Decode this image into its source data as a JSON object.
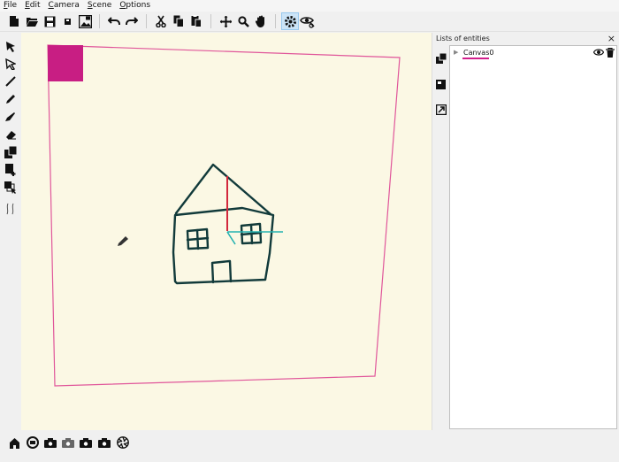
{
  "menu": {
    "file": {
      "label": "File",
      "u": "F",
      "rest": "ile"
    },
    "edit": {
      "label": "Edit",
      "u": "E",
      "rest": "dit"
    },
    "camera": {
      "label": "Camera",
      "u": "C",
      "rest": "amera"
    },
    "scene": {
      "label": "Scene",
      "u": "S",
      "rest": "cene"
    },
    "options": {
      "label": "Options",
      "u": "O",
      "rest": "ptions"
    }
  },
  "toolbar_icons": [
    "new-file-icon",
    "open-folder-icon",
    "save-icon",
    "small-save-icon",
    "export-image-icon",
    "undo-icon",
    "redo-icon",
    "cut-icon",
    "copy-icon",
    "paste-icon",
    "move-icon",
    "zoom-icon",
    "pan-hand-icon",
    "settings-active-icon",
    "view-eye-icon"
  ],
  "left_tool_icons": [
    "select-arrow-icon",
    "select-partial-icon",
    "line-tool-icon",
    "pen-tool-icon",
    "brush-tool-icon",
    "eraser-icon",
    "fill-layer-icon",
    "add-layer-icon",
    "layer-select-icon",
    "stroke-style-icon"
  ],
  "panel": {
    "title": "Lists of entities",
    "close": "×",
    "entities": [
      {
        "name": "Canvas0",
        "underline_color": "#d21f8c"
      }
    ]
  },
  "bottom_icons": [
    "home-icon",
    "camera-reset-icon",
    "camera-1-icon",
    "camera-2-icon",
    "camera-3-icon",
    "camera-4-icon",
    "aperture-icon"
  ],
  "colors": {
    "canvas_bg": "#fbf8e4",
    "canvas_border": "#e0569a",
    "pink_swatch": "#c81e83",
    "house_stroke": "#113a3a",
    "axis_red": "#d2283c",
    "axis_cyan": "#25b2b0"
  }
}
